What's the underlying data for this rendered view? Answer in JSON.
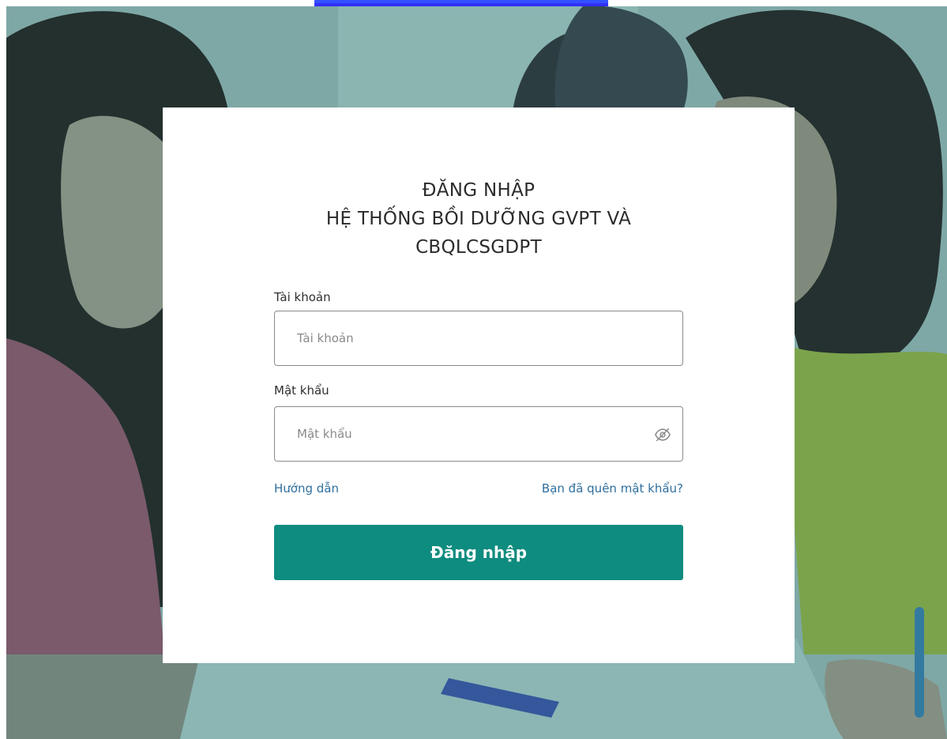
{
  "login": {
    "title_line1": "ĐĂNG NHẬP",
    "title_line2": "HỆ THỐNG BỒI DƯỠNG GVPT VÀ",
    "title_line3": "CBQLCSGDPT",
    "account_label": "Tài khoản",
    "account_placeholder": "Tài khoản",
    "password_label": "Mật khẩu",
    "password_placeholder": "Mật khẩu",
    "guide_link": "Hướng dẫn",
    "forgot_link": "Bạn đã quên mật khẩu?",
    "submit_label": "Đăng nhập"
  },
  "icons": {
    "password_toggle": "eye-slash-icon"
  },
  "colors": {
    "primary_button": "#0e8c7f",
    "link": "#2f6f9e",
    "background_tint": "#167872"
  }
}
